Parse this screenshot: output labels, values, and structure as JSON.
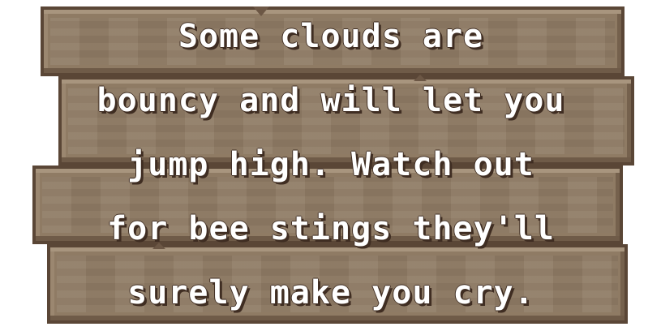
{
  "sign": {
    "lines": [
      "Some clouds are",
      "bouncy and will let you",
      "jump high. Watch out",
      "for bee stings they'll",
      "surely make you cry."
    ]
  }
}
